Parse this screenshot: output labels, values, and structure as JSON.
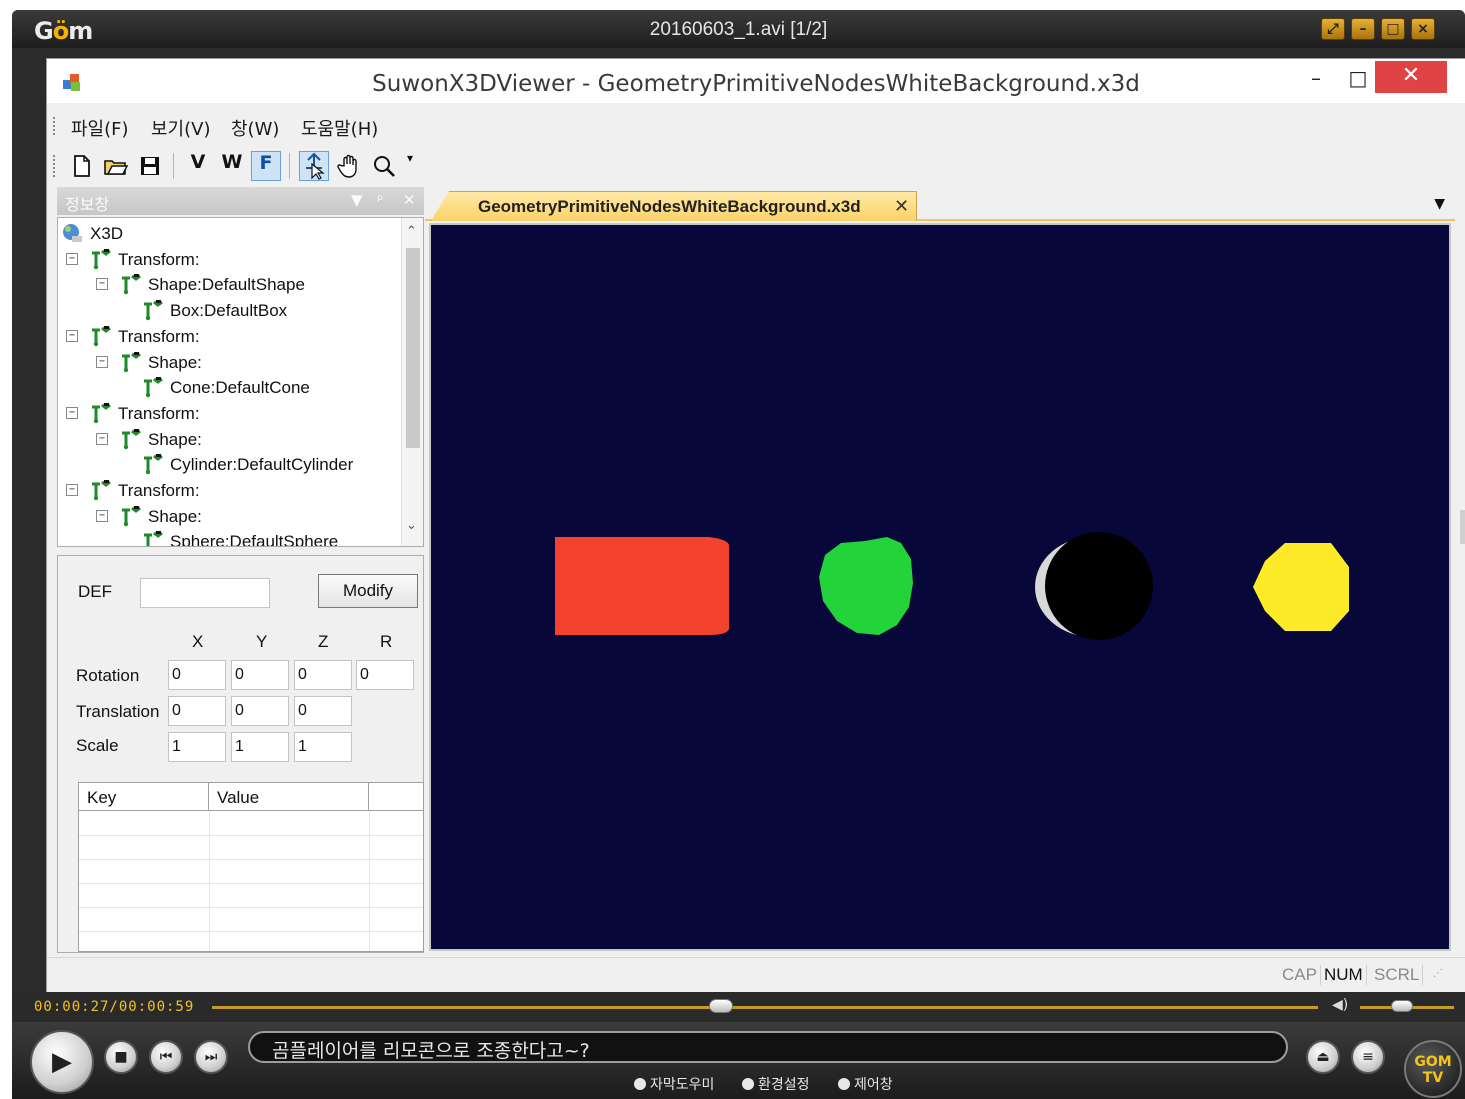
{
  "gom": {
    "filename": "20160603_1.avi  [1/2]",
    "timecode": "00:00:27/00:00:59",
    "subtitle": "곰플레이어를 리모콘으로 조종한다고~?",
    "progress": 0.46,
    "volume": 0.45,
    "bottom_links": [
      "자막도우미",
      "환경설정",
      "제어창"
    ],
    "accent_color": "#f2c122"
  },
  "app": {
    "title": "SuwonX3DViewer - GeometryPrimitiveNodesWhiteBackground.x3d",
    "menu": [
      "파일(F)",
      "보기(V)",
      "창(W)",
      "도움말(H)"
    ],
    "toolbar": {
      "new": "new-file-icon",
      "open": "open-folder-icon",
      "save": "save-disk-icon",
      "v": "V",
      "w": "W",
      "f": "F",
      "select": "select-arrow-icon",
      "pan": "hand-pan-icon",
      "zoom": "magnifier-icon"
    },
    "panel_title": "정보창",
    "tree": [
      {
        "label": "X3D",
        "level": 0
      },
      {
        "label": "Transform:",
        "level": 1
      },
      {
        "label": "Shape:DefaultShape",
        "level": 2
      },
      {
        "label": "Box:DefaultBox",
        "level": 3
      },
      {
        "label": "Transform:",
        "level": 1
      },
      {
        "label": "Shape:",
        "level": 2
      },
      {
        "label": "Cone:DefaultCone",
        "level": 3
      },
      {
        "label": "Transform:",
        "level": 1
      },
      {
        "label": "Shape:",
        "level": 2
      },
      {
        "label": "Cylinder:DefaultCylinder",
        "level": 3
      },
      {
        "label": "Transform:",
        "level": 1
      },
      {
        "label": "Shape:",
        "level": 2
      },
      {
        "label": "Sphere:DefaultSphere",
        "level": 3
      }
    ],
    "props": {
      "def_label": "DEF",
      "def_value": "",
      "modify": "Modify",
      "axes": [
        "X",
        "Y",
        "Z",
        "R"
      ],
      "rotation_label": "Rotation",
      "rotation": [
        "0",
        "0",
        "0",
        "0"
      ],
      "translation_label": "Translation",
      "translation": [
        "0",
        "0",
        "0"
      ],
      "scale_label": "Scale",
      "scale": [
        "1",
        "1",
        "1"
      ],
      "kv_headers": [
        "Key",
        "Value"
      ]
    },
    "doc_tab": "GeometryPrimitiveNodesWhiteBackground.x3d",
    "viewport": {
      "background": "#07073a",
      "shapes": [
        {
          "name": "box",
          "color": "#f4432c"
        },
        {
          "name": "cone",
          "color": "#22d33a"
        },
        {
          "name": "cylinder",
          "color": "#000000"
        },
        {
          "name": "sphere",
          "color": "#fdeb29"
        }
      ]
    },
    "status": {
      "cap": "CAP",
      "num": "NUM",
      "scrl": "SCRL"
    }
  }
}
